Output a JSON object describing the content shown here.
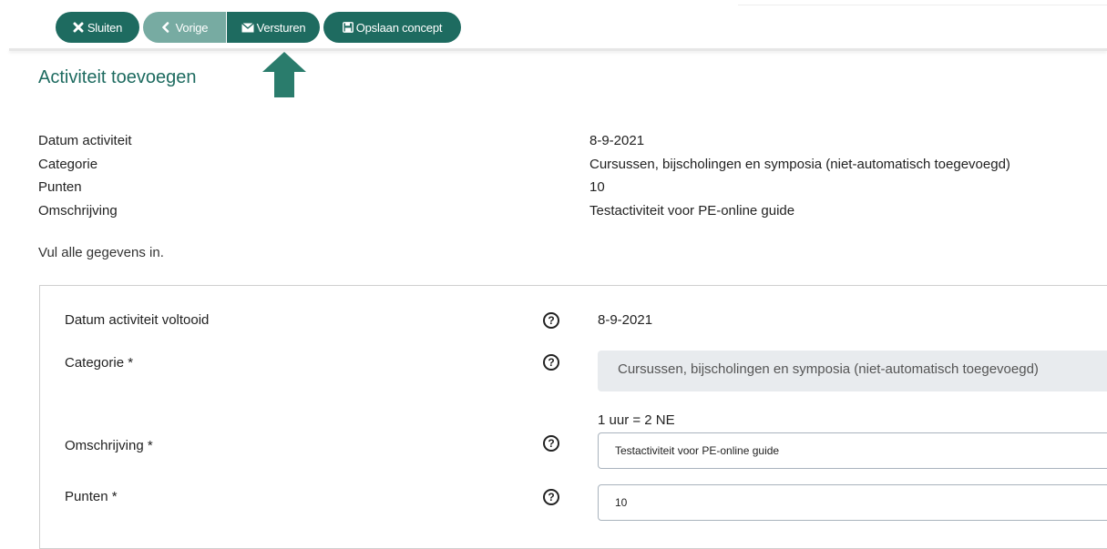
{
  "toolbar": {
    "close_label": "Sluiten",
    "prev_label": "Vorige",
    "send_label": "Versturen",
    "save_label": "Opslaan concept"
  },
  "colors": {
    "primary": "#1e6b60",
    "primary_light": "#77aba2",
    "arrow": "#2a7c6c"
  },
  "page": {
    "title": "Activiteit toevoegen",
    "hint": "Vul alle gegevens in."
  },
  "summary": [
    {
      "label": "Datum activiteit",
      "value": "8-9-2021"
    },
    {
      "label": "Categorie",
      "value": "Cursussen, bijscholingen en symposia (niet-automatisch toegevoegd)"
    },
    {
      "label": "Punten",
      "value": "10"
    },
    {
      "label": "Omschrijving",
      "value": "Testactiviteit voor PE-online guide"
    }
  ],
  "form": {
    "date": {
      "label": "Datum activiteit voltooid",
      "value": "8-9-2021"
    },
    "category": {
      "label": "Categorie *",
      "value": "Cursussen, bijscholingen en symposia (niet-automatisch toegevoegd)"
    },
    "note": "1 uur = 2 NE",
    "description": {
      "label": "Omschrijving *",
      "value": "Testactiviteit voor PE-online guide"
    },
    "points": {
      "label": "Punten *",
      "value": "10"
    },
    "help_symbol": "?"
  },
  "icons": {
    "close": "close-icon",
    "prev": "chevron-left-icon",
    "send": "envelope-icon",
    "save": "floppy-disk-icon",
    "arrow": "arrow-up-icon",
    "help": "help-circle-icon"
  }
}
